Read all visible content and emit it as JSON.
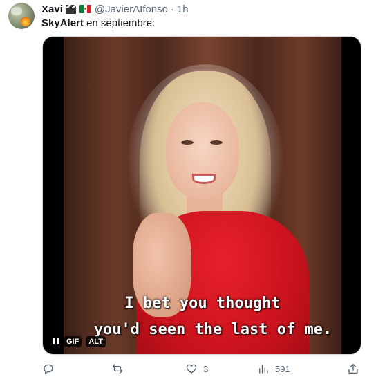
{
  "author": {
    "name": "Xavi",
    "handle": "@JavierAIfonso",
    "separator": "·",
    "time": "1h",
    "emojis": [
      "clapperboard-emoji",
      "mexico-flag-emoji"
    ]
  },
  "tweet": {
    "mention": "SkyAlert",
    "text": " en septiembre:"
  },
  "media": {
    "type": "gif",
    "subtitle_line1": "I bet you thought",
    "subtitle_line2": "you'd seen the last of me.",
    "gif_label": "GIF",
    "alt_label": "ALT"
  },
  "actions": {
    "reply_count": "",
    "retweet_count": "",
    "like_count": "3",
    "views_count": "591"
  },
  "icons": {
    "reply": "reply-icon",
    "retweet": "retweet-icon",
    "like": "heart-icon",
    "views": "views-icon",
    "share": "share-icon"
  },
  "colors": {
    "text_primary": "#0f1419",
    "text_secondary": "#536471",
    "border": "#cfd9de"
  }
}
